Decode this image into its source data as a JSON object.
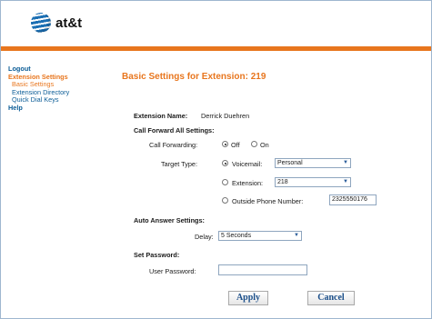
{
  "brand": {
    "name": "at&t",
    "accent": "#e8761e",
    "link_color": "#0c5d97"
  },
  "nav": {
    "logout": "Logout",
    "extension_settings": "Extension Settings",
    "basic_settings": "Basic Settings",
    "extension_directory": "Extension Directory",
    "quick_dial_keys": "Quick Dial Keys",
    "help": "Help"
  },
  "page": {
    "title": "Basic Settings for Extension: 219"
  },
  "form": {
    "extension_name_label": "Extension Name:",
    "extension_name_value": "Derrick Duehren",
    "call_forward_heading": "Call Forward All Settings:",
    "call_forwarding_label": "Call Forwarding:",
    "off_label": "Off",
    "on_label": "On",
    "call_forwarding_value": "Off",
    "target_type_label": "Target Type:",
    "voicemail_label": "Voicemail:",
    "voicemail_value": "Personal",
    "extension_label": "Extension:",
    "extension_value": "218",
    "outside_label": "Outside Phone Number:",
    "outside_value": "2325550176",
    "target_type_value": "Voicemail",
    "auto_answer_heading": "Auto Answer Settings:",
    "delay_label": "Delay:",
    "delay_value": "5 Seconds",
    "set_password_heading": "Set Password:",
    "user_password_label": "User Password:",
    "user_password_value": ""
  },
  "buttons": {
    "apply": "Apply",
    "cancel": "Cancel"
  },
  "icons": {
    "logo": "att-globe-icon",
    "dropdown": "chevron-down-icon"
  }
}
